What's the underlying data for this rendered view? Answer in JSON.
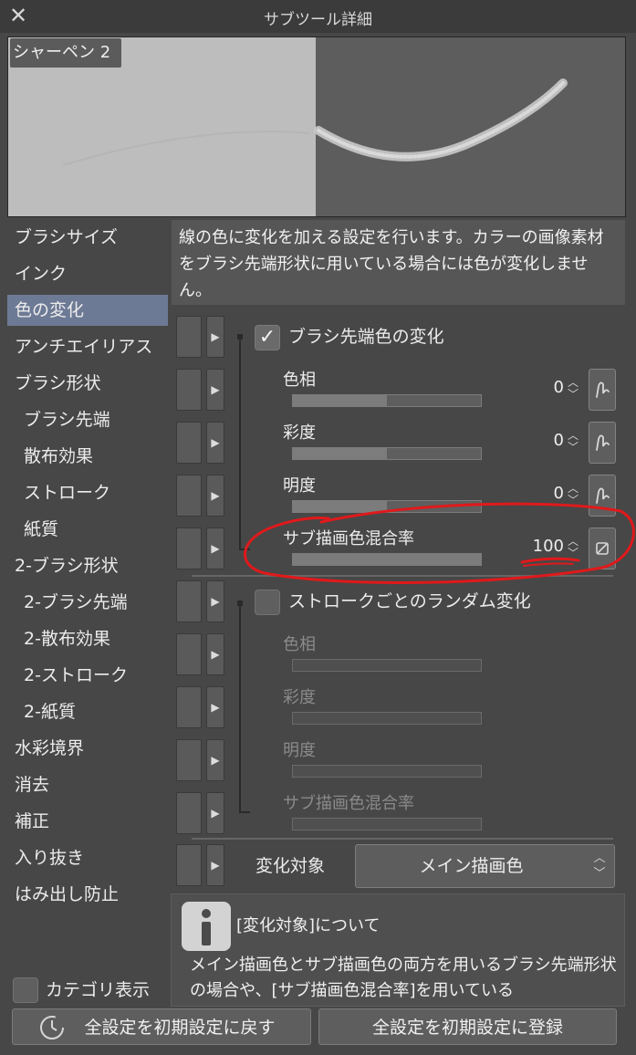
{
  "window": {
    "title": "サブツール詳細",
    "close_icon": "close-icon"
  },
  "preview": {
    "tool_name": "シャーペン 2"
  },
  "categories": [
    {
      "label": "ブラシサイズ",
      "sub": false,
      "active": false
    },
    {
      "label": "インク",
      "sub": false,
      "active": false
    },
    {
      "label": "色の変化",
      "sub": false,
      "active": true
    },
    {
      "label": "アンチエイリアス",
      "sub": false,
      "active": false
    },
    {
      "label": "ブラシ形状",
      "sub": false,
      "active": false
    },
    {
      "label": "ブラシ先端",
      "sub": true,
      "active": false
    },
    {
      "label": "散布効果",
      "sub": true,
      "active": false
    },
    {
      "label": "ストローク",
      "sub": true,
      "active": false
    },
    {
      "label": "紙質",
      "sub": true,
      "active": false
    },
    {
      "label": "2-ブラシ形状",
      "sub": false,
      "active": false
    },
    {
      "label": "2-ブラシ先端",
      "sub": true,
      "active": false
    },
    {
      "label": "2-散布効果",
      "sub": true,
      "active": false
    },
    {
      "label": "2-ストローク",
      "sub": true,
      "active": false
    },
    {
      "label": "2-紙質",
      "sub": true,
      "active": false
    },
    {
      "label": "水彩境界",
      "sub": false,
      "active": false
    },
    {
      "label": "消去",
      "sub": false,
      "active": false
    },
    {
      "label": "補正",
      "sub": false,
      "active": false
    },
    {
      "label": "入り抜き",
      "sub": false,
      "active": false
    },
    {
      "label": "はみ出し防止",
      "sub": false,
      "active": false
    }
  ],
  "description": "線の色に変化を加える設定を行います。カラーの画像素材をブラシ先端形状に用いている場合には色が変化しません。",
  "group1": {
    "label": "ブラシ先端色の変化",
    "checked": true,
    "params": [
      {
        "label": "色相",
        "value": "0",
        "fill": 0.5
      },
      {
        "label": "彩度",
        "value": "0",
        "fill": 0.5
      },
      {
        "label": "明度",
        "value": "0",
        "fill": 0.5
      },
      {
        "label": "サブ描画色混合率",
        "value": "100",
        "fill": 1.0
      }
    ]
  },
  "group2": {
    "label": "ストロークごとのランダム変化",
    "checked": false,
    "params": [
      {
        "label": "色相"
      },
      {
        "label": "彩度"
      },
      {
        "label": "明度"
      },
      {
        "label": "サブ描画色混合率"
      }
    ]
  },
  "target": {
    "label": "変化対象",
    "value": "メイン描画色"
  },
  "info": {
    "title": "[変化対象]について",
    "body": "メイン描画色とサブ描画色の両方を用いるブラシ先端形状の場合や、[サブ描画色混合率]を用いている"
  },
  "category_toggle_label": "カテゴリ表示",
  "buttons": {
    "reset": "全設定を初期設定に戻す",
    "register": "全設定を初期設定に登録"
  },
  "colors": {
    "accent_selected": "#6d7a95",
    "annotation_red": "#e0191b"
  }
}
